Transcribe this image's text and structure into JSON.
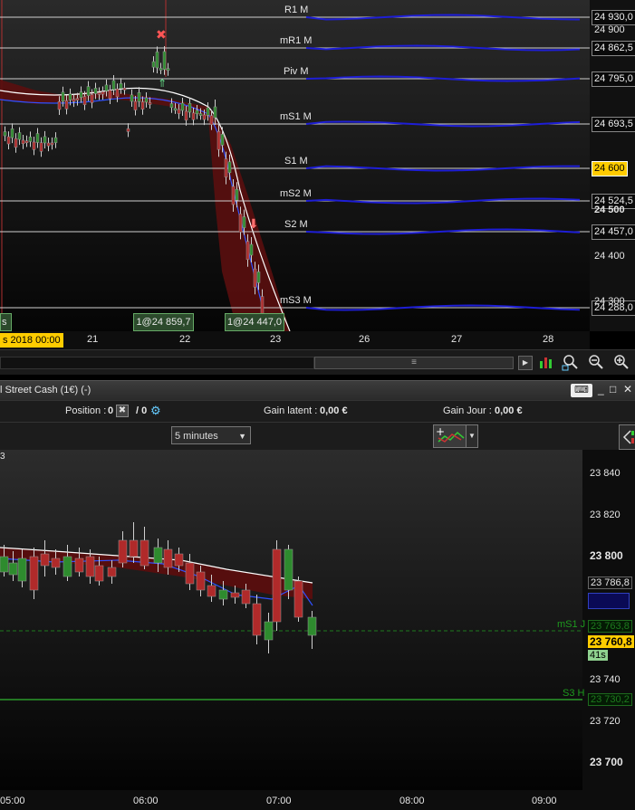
{
  "top_chart": {
    "levels": [
      {
        "name": "R1 M",
        "value": "24 930,0"
      },
      {
        "name": "mR1 M",
        "value": "24 862,5"
      },
      {
        "name": "Piv M",
        "value": "24 795,0"
      },
      {
        "name": "mS1 M",
        "value": "24 693,5"
      },
      {
        "name": "S1 M",
        "value": "24 600"
      },
      {
        "name": "mS2 M",
        "value": "24 524,5"
      },
      {
        "name": "S2 M",
        "value": "24 457,0"
      },
      {
        "name": "mS3 M",
        "value": "24 288,0"
      }
    ],
    "axis_ticks": [
      "24 900",
      "24 500",
      "24 400",
      "24 300"
    ],
    "orders": [
      "1@24 859,7",
      "1@24 447,0"
    ],
    "left_tag": "s",
    "date_label": "s 2018 00:00",
    "x_ticks": [
      "21",
      "22",
      "23",
      "26",
      "27",
      "28"
    ]
  },
  "scroll": {
    "grip": "≡"
  },
  "window": {
    "title": "l Street Cash (1€) (-)",
    "controls": {
      "keyboard": "⌨",
      "minimize": "_",
      "maximize": "□",
      "close": "✕"
    }
  },
  "info": {
    "position_label": "Position :",
    "position_value": "0",
    "ratio_value": "/ 0",
    "latent_label": "Gain latent :",
    "latent_value": "0,00 €",
    "day_label": "Gain Jour :",
    "day_value": "0,00 €"
  },
  "toolbar": {
    "interval": "5 minutes"
  },
  "bottom_chart": {
    "corner_label": "3",
    "y_ticks": [
      "23 840",
      "23 820",
      "23 800",
      "23 786,8",
      "23 763,8",
      "23 760,8",
      "23 740",
      "23 730,2",
      "23 720",
      "23 700"
    ],
    "timer": "41s",
    "line_labels": {
      "ms1": "mS1 J",
      "s3": "S3 H"
    },
    "x_ticks": [
      "05:00",
      "06:00",
      "07:00",
      "08:00",
      "09:00"
    ]
  },
  "colors": {
    "up": "#2e8b2e",
    "down": "#b02a2a",
    "pivot_line": "#1e1ed6",
    "band": "#5a0e0e",
    "accent_price": "#ffcc00",
    "timer_bg": "#8fd18f"
  }
}
